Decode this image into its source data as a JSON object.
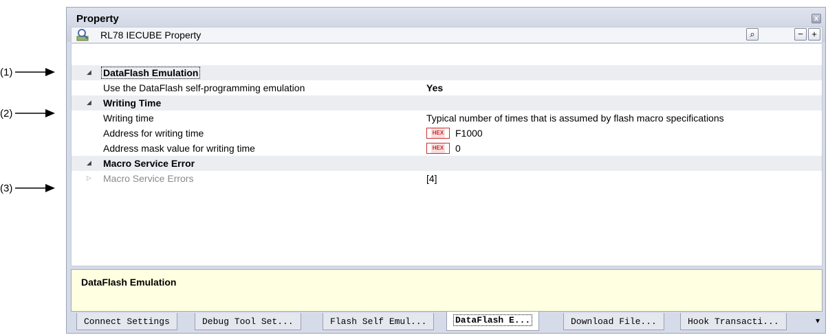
{
  "callouts": [
    "(1)",
    "(2)",
    "(3)"
  ],
  "window": {
    "title": "Property",
    "close_glyph": "x"
  },
  "toolbar": {
    "title": "RL78 IECUBE Property",
    "search_glyph": "⌕",
    "collapse_glyph": "−",
    "expand_glyph": "+"
  },
  "grid": {
    "categories": [
      {
        "label": "DataFlash Emulation",
        "properties": [
          {
            "name": "Use the DataFlash self-programming emulation",
            "value": "Yes"
          }
        ]
      },
      {
        "label": "Writing Time",
        "properties": [
          {
            "name": "Writing time",
            "value": "Typical number of times that is assumed by flash macro specifications"
          },
          {
            "name": "Address for writing time",
            "hex_badge": "HEX",
            "value": "F1000"
          },
          {
            "name": "Address mask value for writing time",
            "hex_badge": "HEX",
            "value": "0"
          }
        ]
      },
      {
        "label": "Macro Service Error",
        "properties": [
          {
            "name": "Macro Service Errors",
            "value": "[4]"
          }
        ]
      }
    ],
    "expand_glyph": "◢",
    "subexpand_glyph": "▷"
  },
  "description": {
    "title": "DataFlash Emulation"
  },
  "tabs": [
    {
      "label": "Connect Settings"
    },
    {
      "label": "Debug Tool Set..."
    },
    {
      "label": "Flash Self Emul..."
    },
    {
      "label": "DataFlash E...",
      "active": true
    },
    {
      "label": "Download File..."
    },
    {
      "label": "Hook Transacti..."
    }
  ],
  "tab_menu_glyph": "▾"
}
